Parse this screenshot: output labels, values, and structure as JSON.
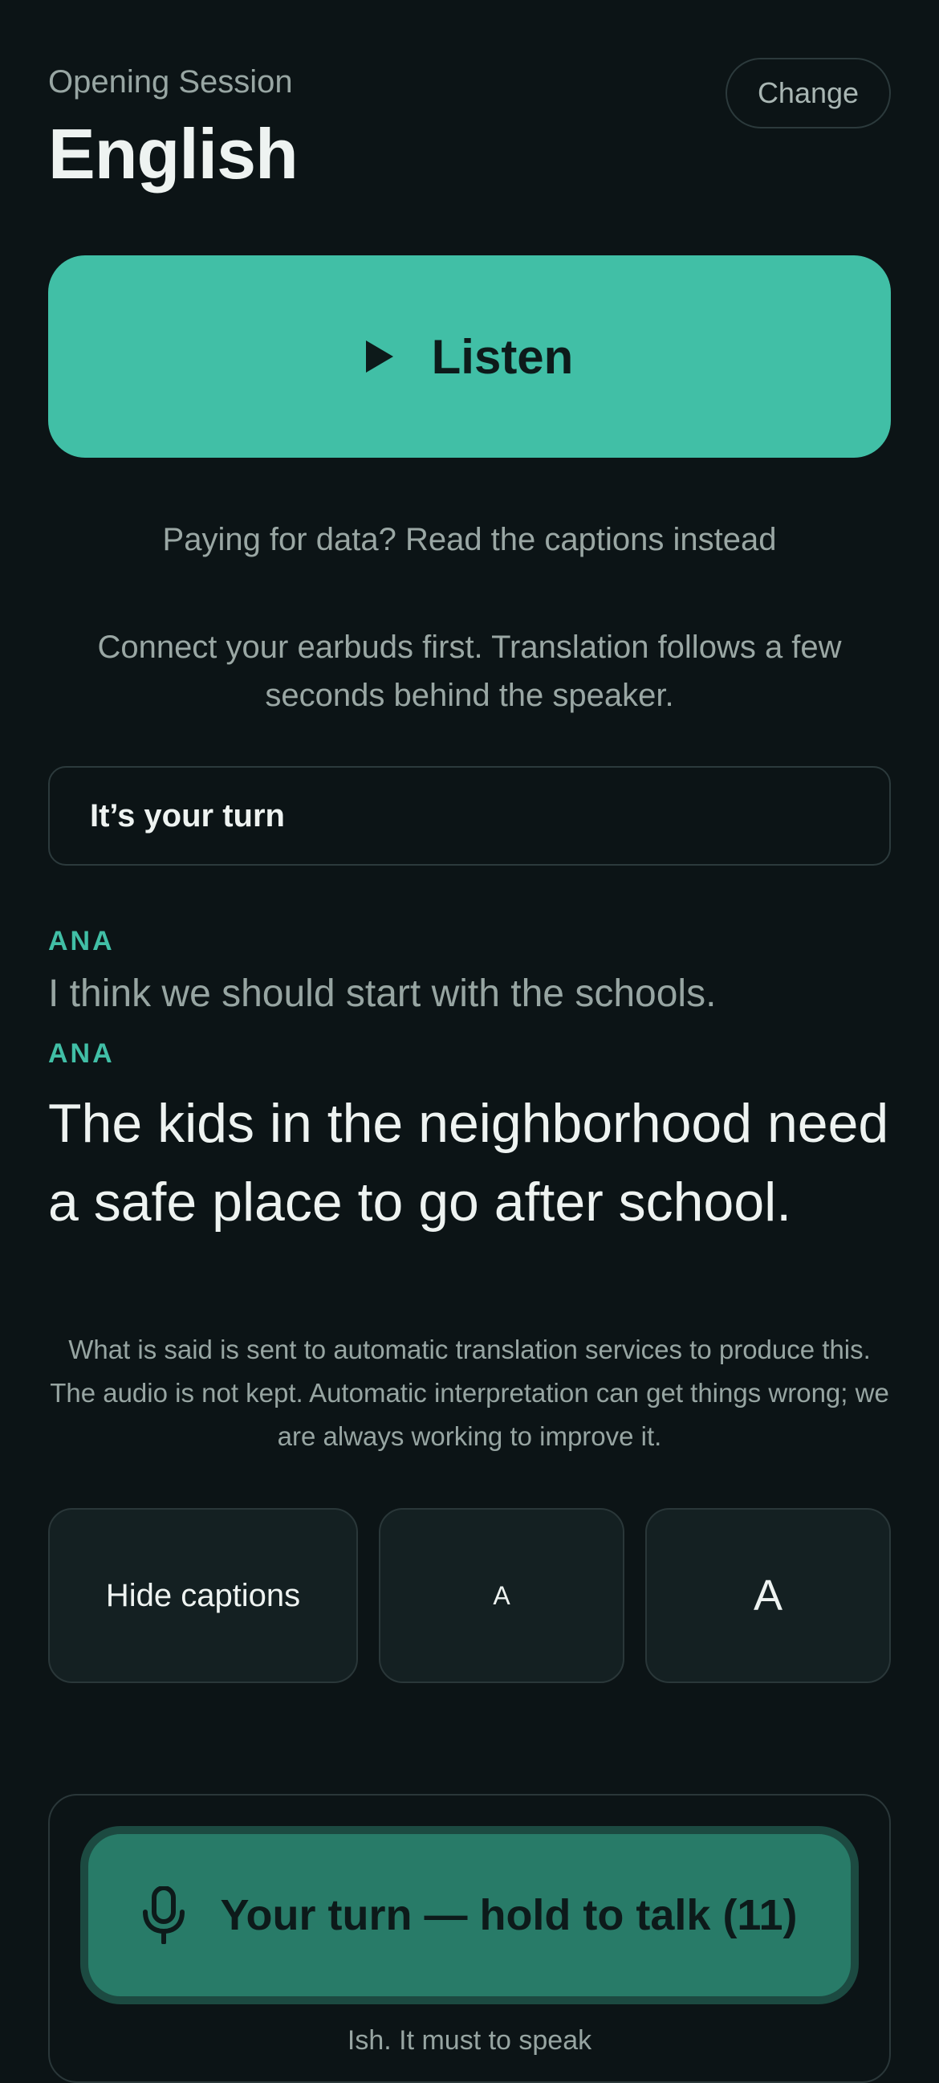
{
  "header": {
    "session_label": "Opening Session",
    "language": "English",
    "change_label": "Change"
  },
  "listen": {
    "label": "Listen",
    "icon": "play-icon"
  },
  "data_link": "Paying for data? Read the captions instead",
  "earbuds_note": "Connect your earbuds first. Translation follows a few seconds behind the speaker.",
  "turn_status": "It’s your turn",
  "captions": {
    "previous": {
      "speaker": "ANA",
      "text": "I think we should start with the schools."
    },
    "current": {
      "speaker": "ANA",
      "text": "The kids in the neighborhood need a safe place to go after school."
    }
  },
  "disclaimer": "What is said is sent to automatic translation services to produce this. The audio is not kept. Automatic interpretation can get things wrong; we are always working to improve it.",
  "controls": {
    "hide_captions": "Hide captions",
    "text_small": "A",
    "text_large": "A"
  },
  "talk": {
    "label": "Your turn — hold to talk (11)",
    "icon": "microphone-icon",
    "hint": "Ish. It must to speak"
  },
  "colors": {
    "background": "#0c1416",
    "accent": "#41bfa6",
    "talk_button": "#287b68"
  }
}
